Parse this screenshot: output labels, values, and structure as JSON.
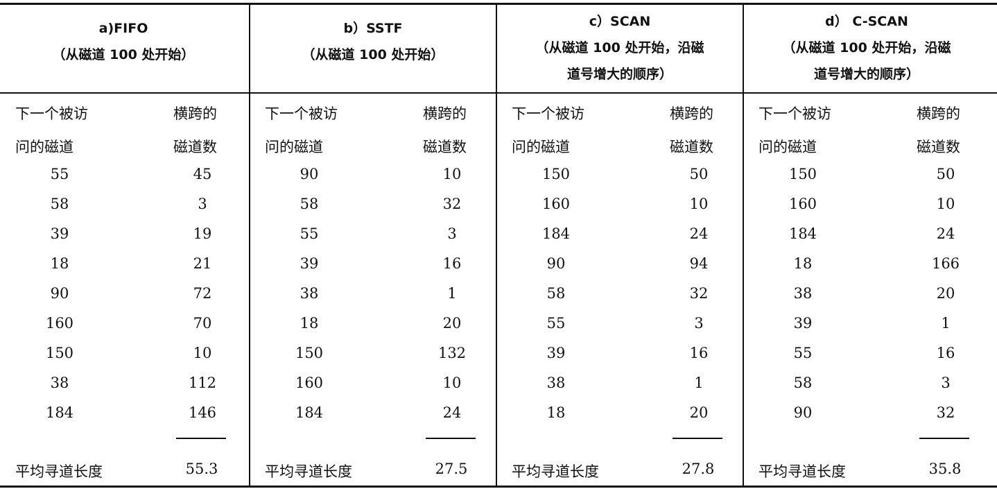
{
  "columns": [
    {
      "title": "a)FIFO",
      "subtitle_lines": [
        "（从磁道 100 处开始）"
      ],
      "label_next": [
        "下一个被访",
        "问的磁道"
      ],
      "label_cross": [
        "横跨的",
        "磁道数"
      ],
      "rows": [
        [
          "55",
          "45"
        ],
        [
          "58",
          "3"
        ],
        [
          "39",
          "19"
        ],
        [
          "18",
          "21"
        ],
        [
          "90",
          "72"
        ],
        [
          "160",
          "70"
        ],
        [
          "150",
          "10"
        ],
        [
          "38",
          "112"
        ],
        [
          "184",
          "146"
        ]
      ],
      "avg_label": "平均寻道长度",
      "avg_value": "55.3"
    },
    {
      "title": "b）SSTF",
      "subtitle_lines": [
        "（从磁道 100 处开始）"
      ],
      "label_next": [
        "下一个被访",
        "问的磁道"
      ],
      "label_cross": [
        "横跨的",
        "磁道数"
      ],
      "rows": [
        [
          "90",
          "10"
        ],
        [
          "58",
          "32"
        ],
        [
          "55",
          "3"
        ],
        [
          "39",
          "16"
        ],
        [
          "38",
          "1"
        ],
        [
          "18",
          "20"
        ],
        [
          "150",
          "132"
        ],
        [
          "160",
          "10"
        ],
        [
          "184",
          "24"
        ]
      ],
      "avg_label": "平均寻道长度",
      "avg_value": "27.5"
    },
    {
      "title": "c）SCAN",
      "subtitle_lines": [
        "（从磁道 100 处开始，沿磁",
        "道号增大的顺序）"
      ],
      "label_next": [
        "下一个被访",
        "问的磁道"
      ],
      "label_cross": [
        "横跨的",
        "磁道数"
      ],
      "rows": [
        [
          "150",
          "50"
        ],
        [
          "160",
          "10"
        ],
        [
          "184",
          "24"
        ],
        [
          "90",
          "94"
        ],
        [
          "58",
          "32"
        ],
        [
          "55",
          "3"
        ],
        [
          "39",
          "16"
        ],
        [
          "38",
          "1"
        ],
        [
          "18",
          "20"
        ]
      ],
      "avg_label": "平均寻道长度",
      "avg_value": "27.8"
    },
    {
      "title": "d）  C-SCAN",
      "subtitle_lines": [
        "（从磁道 100 处开始，沿磁",
        "道号增大的顺序）"
      ],
      "label_next": [
        "下一个被访",
        "问的磁道"
      ],
      "label_cross": [
        "横跨的",
        "磁道数"
      ],
      "rows": [
        [
          "150",
          "50"
        ],
        [
          "160",
          "10"
        ],
        [
          "184",
          "24"
        ],
        [
          "18",
          "166"
        ],
        [
          "38",
          "20"
        ],
        [
          "39",
          "1"
        ],
        [
          "55",
          "16"
        ],
        [
          "58",
          "3"
        ],
        [
          "90",
          "32"
        ]
      ],
      "avg_label": "平均寻道长度",
      "avg_value": "35.8"
    }
  ]
}
